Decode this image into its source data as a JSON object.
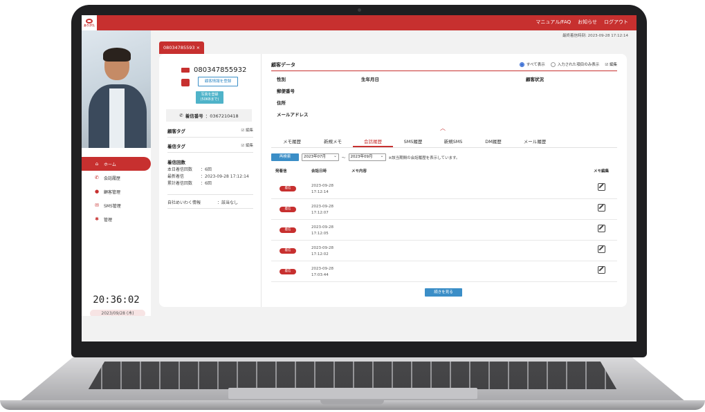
{
  "app": {
    "logo_text": "ありがた",
    "top_nav": [
      "マニュアル/FAQ",
      "お知らせ",
      "ログアウト"
    ],
    "last_call": "最終着信時刻: 2023-09-28 17:12:14"
  },
  "sidebar": {
    "items": [
      {
        "label": "ホーム",
        "icon": "home-icon",
        "active": true
      },
      {
        "label": "会話履歴",
        "icon": "phone-icon",
        "active": false
      },
      {
        "label": "顧客管理",
        "icon": "user-icon",
        "active": false
      },
      {
        "label": "SMS管理",
        "icon": "mail-icon",
        "active": false
      },
      {
        "label": "管理",
        "icon": "gear-icon",
        "active": false
      }
    ],
    "clock": "20:36:02",
    "date": "2023/09/28 (木)"
  },
  "tab": {
    "label": "08034785593"
  },
  "customer": {
    "phone": "080347855932",
    "register_label": "顧客情報を登録",
    "photo_label_1": "写真を登録",
    "photo_label_2": "(50KBまで)",
    "incoming_label": "着信番号",
    "incoming_number": "：0367210418",
    "customer_tag": "顧客タグ",
    "incoming_tag": "着信タグ",
    "edit_label": "☑ 編集",
    "count_title": "着信回数",
    "today_label": "本日着信回数",
    "today_value": "：6回",
    "latest_label": "最新着信",
    "latest_value": "：2023-09-28 17:12:14",
    "total_label": "累計着信回数",
    "total_value": "：6回",
    "ext_label": "自社めいわく情報",
    "ext_value": "：該当なし"
  },
  "customer_data": {
    "title": "顧客データ",
    "radio_all": "すべて表示",
    "radio_filled": "入力された項目のみ表示",
    "edit_label": "☑ 編集",
    "fields": {
      "gender": "性別",
      "birthday": "生年月日",
      "status": "顧客状況",
      "postal": "郵便番号",
      "address": "住所",
      "email": "メールアドレス"
    }
  },
  "history_tabs": [
    "メモ履歴",
    "新規メモ",
    "会話履歴",
    "SMS履歴",
    "新規SMS",
    "DM履歴",
    "メール履歴"
  ],
  "active_history_tab": 2,
  "filter": {
    "search_label": "再検索",
    "from": "2023年07月",
    "to": "2023年09月",
    "tilde": "〜",
    "note": "※該当期間の会話履歴を表示しています。"
  },
  "table": {
    "headers": {
      "type": "発着信",
      "datetime": "会話日時",
      "memo": "メモ内容",
      "memo_edit": "メモ編集"
    },
    "rows": [
      {
        "badge": "着信",
        "date": "2023-09-28",
        "time": "17:12:14"
      },
      {
        "badge": "着信",
        "date": "2023-09-28",
        "time": "17:12:07"
      },
      {
        "badge": "着信",
        "date": "2023-09-28",
        "time": "17:12:05"
      },
      {
        "badge": "着信",
        "date": "2023-09-28",
        "time": "17:12:02"
      },
      {
        "badge": "着信",
        "date": "2023-09-28",
        "time": "17:03:44"
      }
    ],
    "more_label": "続きを見る"
  },
  "colors": {
    "brand": "#c7302f",
    "action": "#3b8ec7",
    "photo_button": "#4fb3c9"
  }
}
